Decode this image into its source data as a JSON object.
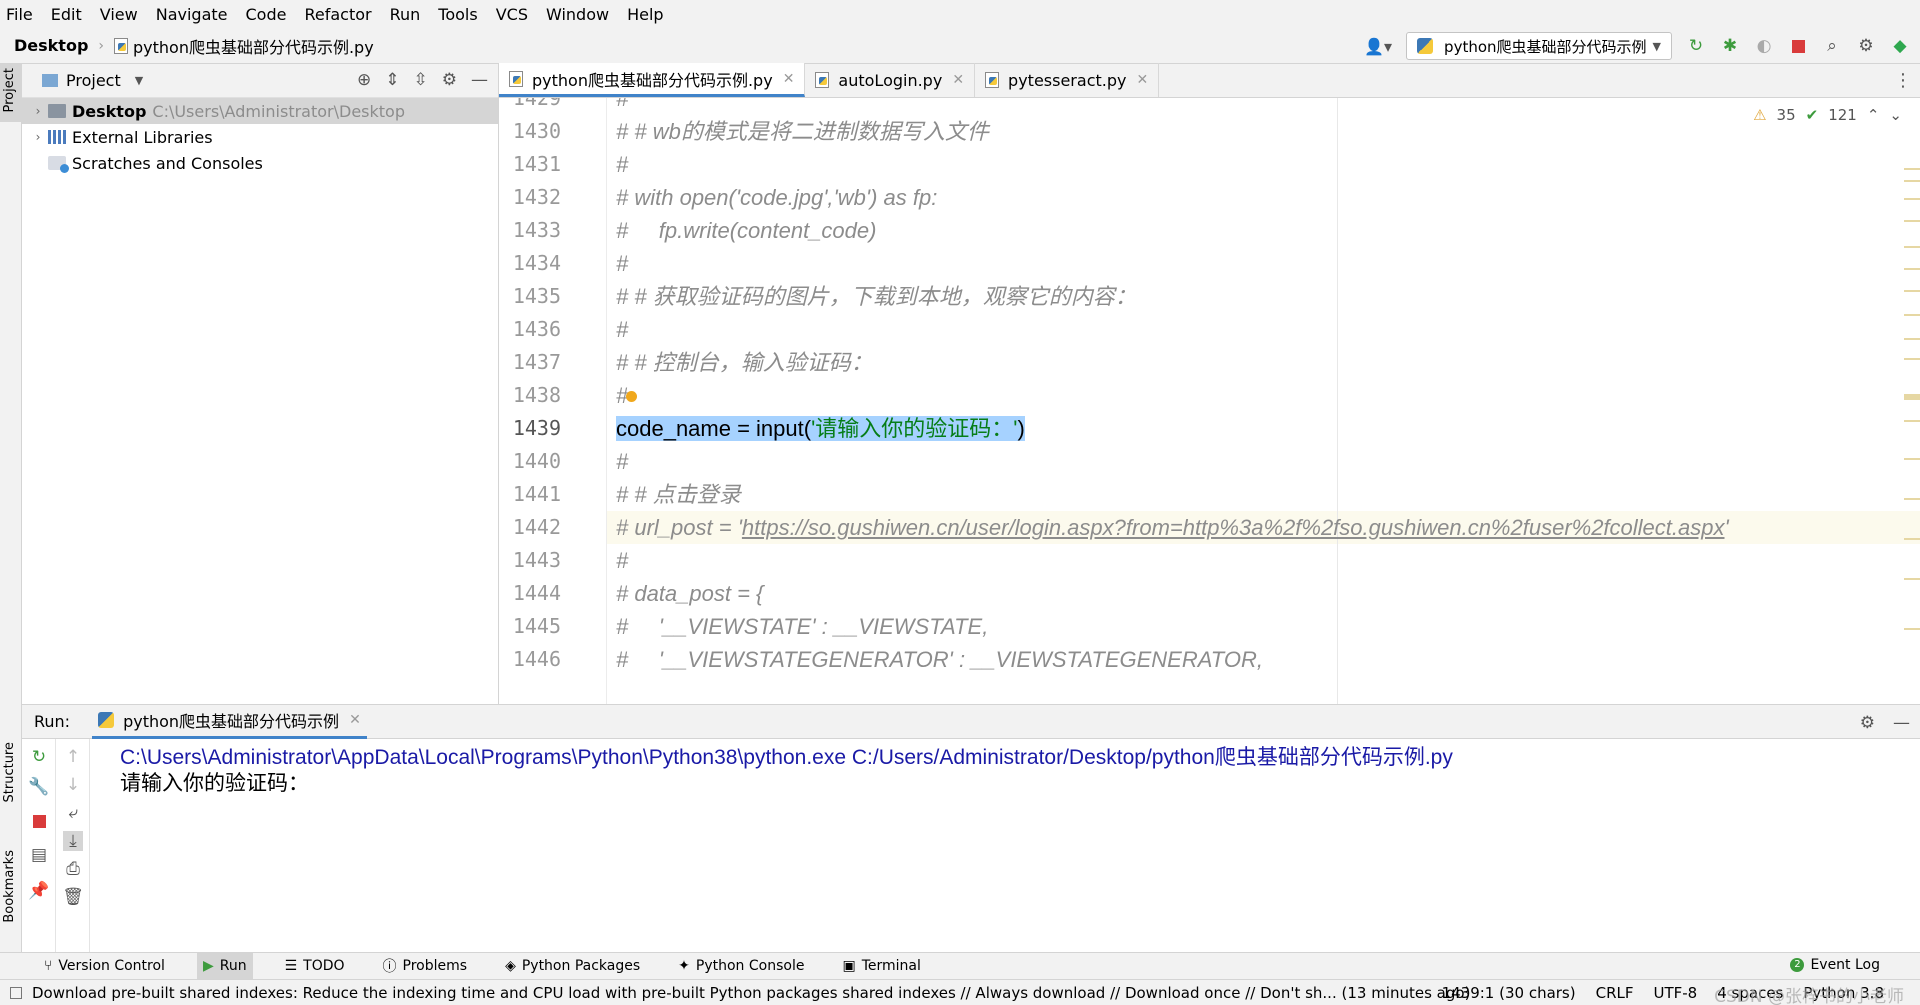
{
  "menu": [
    "File",
    "Edit",
    "View",
    "Navigate",
    "Code",
    "Refactor",
    "Run",
    "Tools",
    "VCS",
    "Window",
    "Help"
  ],
  "breadcrumb": {
    "root": "Desktop",
    "file": "python爬虫基础部分代码示例.py"
  },
  "run_config": {
    "name": "python爬虫基础部分代码示例"
  },
  "project_panel": {
    "title": "Project",
    "tree": [
      {
        "label": "Desktop",
        "path": "C:\\Users\\Administrator\\Desktop"
      },
      {
        "label": "External Libraries"
      },
      {
        "label": "Scratches and Consoles"
      }
    ]
  },
  "side_tabs": {
    "project": "Project",
    "structure": "Structure",
    "bookmarks": "Bookmarks"
  },
  "editor_tabs": [
    {
      "label": "python爬虫基础部分代码示例.py"
    },
    {
      "label": "autoLogin.py"
    },
    {
      "label": "pytesseract.py"
    }
  ],
  "inspections": {
    "warnings": "35",
    "typos": "121"
  },
  "code": {
    "lines": [
      {
        "num": "1429",
        "text": "#"
      },
      {
        "num": "1430",
        "text": "# # wb的模式是将二进制数据写入文件"
      },
      {
        "num": "1431",
        "text": "#"
      },
      {
        "num": "1432",
        "text": "# with open('code.jpg','wb') as fp:"
      },
      {
        "num": "1433",
        "text": "#     fp.write(content_code)"
      },
      {
        "num": "1434",
        "text": "#"
      },
      {
        "num": "1435",
        "text": "# # 获取验证码的图片，下载到本地，观察它的内容："
      },
      {
        "num": "1436",
        "text": "#"
      },
      {
        "num": "1437",
        "text": "# # 控制台，输入验证码："
      },
      {
        "num": "1438",
        "text": "#"
      },
      {
        "num": "1439",
        "text": ""
      },
      {
        "num": "1440",
        "text": "#"
      },
      {
        "num": "1441",
        "text": "# # 点击登录"
      },
      {
        "num": "1442",
        "text": "# url_post = '"
      },
      {
        "num": "1443",
        "text": "#"
      },
      {
        "num": "1444",
        "text": "# data_post = {"
      },
      {
        "num": "1445",
        "text": "#     '__VIEWSTATE' : __VIEWSTATE,"
      },
      {
        "num": "1446",
        "text": "#     '__VIEWSTATEGENERATOR' : __VIEWSTATEGENERATOR,"
      }
    ],
    "current_code": "code_name = input(",
    "current_str": "'请输入你的验证码：'",
    "current_close": ")",
    "url": "https://so.gushiwen.cn/user/login.aspx?from=http%3a%2f%2fso.gushiwen.cn%2fuser%2fcollect.aspx",
    "url_tail": "'"
  },
  "run_panel": {
    "label": "Run:",
    "tab": "python爬虫基础部分代码示例",
    "console": [
      "C:\\Users\\Administrator\\AppData\\Local\\Programs\\Python\\Python38\\python.exe C:/Users/Administrator/Desktop/python爬虫基础部分代码示例.py",
      "请输入你的验证码："
    ]
  },
  "bottom_tabs": [
    "Version Control",
    "Run",
    "TODO",
    "Problems",
    "Python Packages",
    "Python Console",
    "Terminal"
  ],
  "event_log": "Event Log",
  "status": {
    "message": "Download pre-built shared indexes: Reduce the indexing time and CPU load with pre-built Python packages shared indexes // Always download // Download once // Don't sh... (13 minutes ago)",
    "position": "1439:1 (30 chars)",
    "line_sep": "CRLF",
    "encoding": "UTF-8",
    "indent": "4 spaces",
    "interpreter": "Python 3.8"
  },
  "watermark": "CSDN @张梓书的小老师",
  "colors": {
    "accent": "#4083c9",
    "string": "#067d17",
    "selection": "#a6d2ff",
    "comment": "#8c8c8c"
  }
}
